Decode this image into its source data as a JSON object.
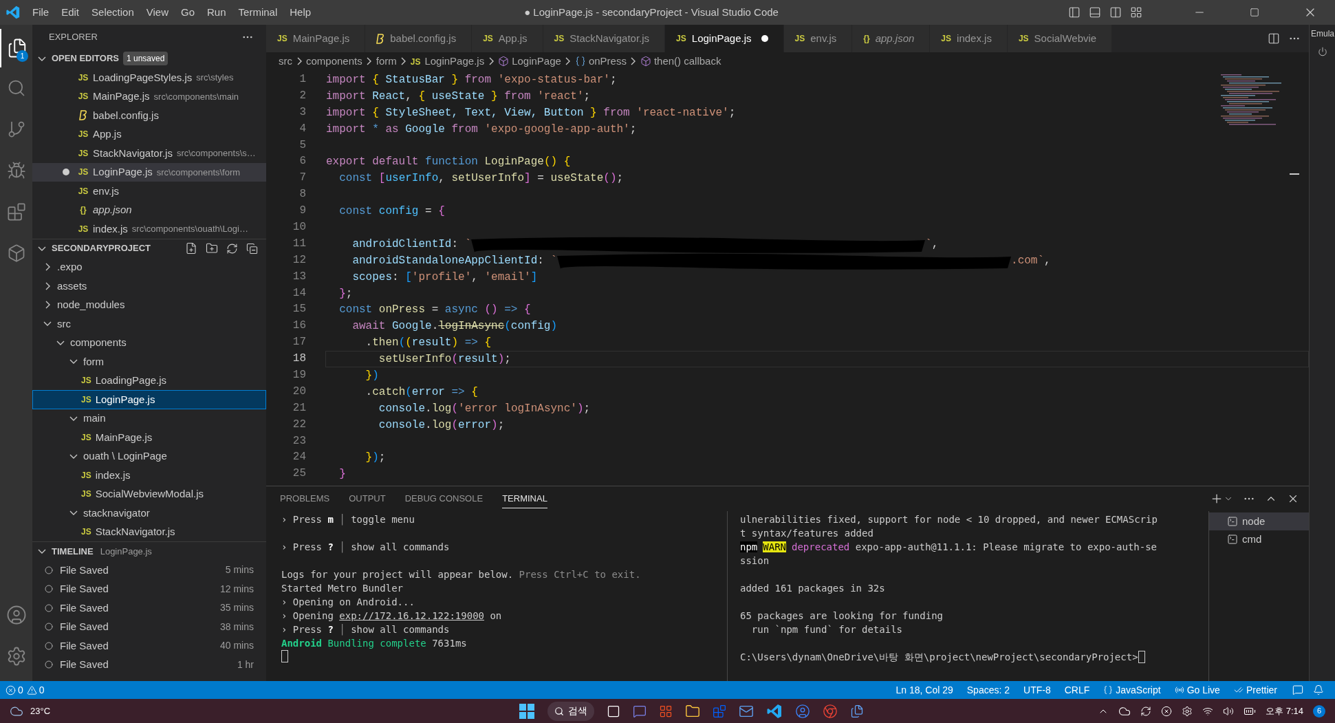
{
  "title_bar": {
    "menus": [
      "File",
      "Edit",
      "Selection",
      "View",
      "Go",
      "Run",
      "Terminal",
      "Help"
    ],
    "title": "● LoginPage.js - secondaryProject - Visual Studio Code"
  },
  "activity_bar": {
    "explorer_badge": "1"
  },
  "sidebar": {
    "title": "EXPLORER",
    "open_editors": {
      "title": "OPEN EDITORS",
      "badge": "1 unsaved",
      "items": [
        {
          "name": "LoadingPageStyles.js",
          "path": "src\\styles",
          "kind": "js",
          "icon_text": "JS",
          "modified": false,
          "selected": false,
          "preview": false
        },
        {
          "name": "MainPage.js",
          "path": "src\\components\\main",
          "kind": "js",
          "icon_text": "JS",
          "modified": false,
          "selected": false,
          "preview": false
        },
        {
          "name": "babel.config.js",
          "kind": "babel",
          "modified": false,
          "selected": false,
          "preview": false
        },
        {
          "name": "App.js",
          "kind": "js",
          "icon_text": "JS",
          "modified": false,
          "selected": false,
          "preview": false
        },
        {
          "name": "StackNavigator.js",
          "path": "src\\components\\s…",
          "kind": "js",
          "icon_text": "JS",
          "modified": false,
          "selected": false,
          "preview": false
        },
        {
          "name": "LoginPage.js",
          "path": "src\\components\\form",
          "kind": "js",
          "icon_text": "JS",
          "modified": true,
          "selected": true,
          "preview": false
        },
        {
          "name": "env.js",
          "kind": "js",
          "icon_text": "JS",
          "modified": false,
          "selected": false,
          "preview": false
        },
        {
          "name": "app.json",
          "kind": "json",
          "icon_text": "{}",
          "modified": false,
          "selected": false,
          "preview": true
        },
        {
          "name": "index.js",
          "path": "src\\components\\ouath\\Logi…",
          "kind": "js",
          "icon_text": "JS",
          "modified": false,
          "selected": false,
          "preview": false
        }
      ]
    },
    "project": {
      "title": "SECONDARYPROJECT",
      "tree": [
        {
          "label": ".expo",
          "kind": "folder",
          "expanded": false,
          "selected": false
        },
        {
          "label": "assets",
          "kind": "folder",
          "expanded": false,
          "selected": false
        },
        {
          "label": "node_modules",
          "kind": "folder",
          "expanded": false,
          "selected": false
        },
        {
          "label": "src",
          "kind": "folder",
          "expanded": true,
          "selected": false,
          "children": [
            {
              "label": "components",
              "kind": "folder",
              "expanded": true,
              "selected": false,
              "children": [
                {
                  "label": "form",
                  "kind": "folder",
                  "expanded": true,
                  "selected": false,
                  "children": [
                    {
                      "label": "LoadingPage.js",
                      "kind": "file",
                      "icon_text": "JS",
                      "selected": false
                    },
                    {
                      "label": "LoginPage.js",
                      "kind": "file",
                      "icon_text": "JS",
                      "selected": true
                    }
                  ]
                },
                {
                  "label": "main",
                  "kind": "folder",
                  "expanded": true,
                  "selected": false,
                  "children": [
                    {
                      "label": "MainPage.js",
                      "kind": "file",
                      "icon_text": "JS",
                      "selected": false
                    }
                  ]
                },
                {
                  "label": "ouath \\ LoginPage",
                  "kind": "folder",
                  "expanded": true,
                  "selected": false,
                  "children": [
                    {
                      "label": "index.js",
                      "kind": "file",
                      "icon_text": "JS",
                      "selected": false
                    },
                    {
                      "label": "SocialWebviewModal.js",
                      "kind": "file",
                      "icon_text": "JS",
                      "selected": false
                    }
                  ]
                },
                {
                  "label": "stacknavigator",
                  "kind": "folder",
                  "expanded": true,
                  "selected": false,
                  "children": [
                    {
                      "label": "StackNavigator.js",
                      "kind": "file",
                      "icon_text": "JS",
                      "selected": false
                    }
                  ]
                }
              ]
            }
          ]
        }
      ]
    },
    "timeline": {
      "title": "TIMELINE",
      "subtitle": "LoginPage.js",
      "items": [
        {
          "label": "File Saved",
          "time": "5 mins"
        },
        {
          "label": "File Saved",
          "time": "12 mins"
        },
        {
          "label": "File Saved",
          "time": "35 mins"
        },
        {
          "label": "File Saved",
          "time": "38 mins"
        },
        {
          "label": "File Saved",
          "time": "40 mins"
        },
        {
          "label": "File Saved",
          "time": "1 hr"
        }
      ]
    }
  },
  "tabs": [
    {
      "label": "MainPage.js",
      "kind": "js",
      "icon_text": "JS",
      "selected": false,
      "modified": false,
      "preview": false
    },
    {
      "label": "babel.config.js",
      "kind": "babel",
      "selected": false,
      "modified": false,
      "preview": false
    },
    {
      "label": "App.js",
      "kind": "js",
      "icon_text": "JS",
      "selected": false,
      "modified": false,
      "preview": false
    },
    {
      "label": "StackNavigator.js",
      "kind": "js",
      "icon_text": "JS",
      "selected": false,
      "modified": false,
      "preview": false
    },
    {
      "label": "LoginPage.js",
      "kind": "js",
      "icon_text": "JS",
      "selected": true,
      "modified": true,
      "preview": false
    },
    {
      "label": "env.js",
      "kind": "js",
      "icon_text": "JS",
      "selected": false,
      "modified": false,
      "preview": false
    },
    {
      "label": "app.json",
      "kind": "json",
      "icon_text": "{}",
      "selected": false,
      "modified": false,
      "preview": true
    },
    {
      "label": "index.js",
      "kind": "js",
      "icon_text": "JS",
      "selected": false,
      "modified": false,
      "preview": false
    },
    {
      "label": "SocialWebvie",
      "kind": "js",
      "icon_text": "JS",
      "selected": false,
      "modified": false,
      "preview": false
    }
  ],
  "breadcrumb": [
    {
      "text": "src",
      "kind": "folder"
    },
    {
      "text": "components",
      "kind": "folder"
    },
    {
      "text": "form",
      "kind": "folder"
    },
    {
      "text": "LoginPage.js",
      "kind": "file",
      "icon_text": "JS"
    },
    {
      "text": "LoginPage",
      "kind": "function"
    },
    {
      "text": "onPress",
      "kind": "variable"
    },
    {
      "text": "then() callback",
      "kind": "function"
    }
  ],
  "editor": {
    "lines": [
      {
        "number": "1",
        "current": false,
        "tokens": [
          {
            "text": "import ",
            "kind": "kw"
          },
          {
            "text": "{",
            "kind": "b1"
          },
          {
            "text": " StatusBar ",
            "kind": "var"
          },
          {
            "text": "}",
            "kind": "b1"
          },
          {
            "text": " from ",
            "kind": "kw"
          },
          {
            "text": "'expo-status-bar'",
            "kind": "str"
          },
          {
            "text": ";",
            "kind": "p"
          }
        ]
      },
      {
        "number": "2",
        "current": false,
        "tokens": [
          {
            "text": "import",
            "kind": "kw"
          },
          {
            "text": " React",
            "kind": "var"
          },
          {
            "text": ", ",
            "kind": "p"
          },
          {
            "text": "{",
            "kind": "b1"
          },
          {
            "text": " useState ",
            "kind": "var"
          },
          {
            "text": "}",
            "kind": "b1"
          },
          {
            "text": " from ",
            "kind": "kw"
          },
          {
            "text": "'react'",
            "kind": "str"
          },
          {
            "text": ";",
            "kind": "p"
          }
        ]
      },
      {
        "number": "3",
        "current": false,
        "tokens": [
          {
            "text": "import ",
            "kind": "kw"
          },
          {
            "text": "{",
            "kind": "b1"
          },
          {
            "text": " StyleSheet, Text, View, Button ",
            "kind": "var"
          },
          {
            "text": "}",
            "kind": "b1"
          },
          {
            "text": " from ",
            "kind": "kw"
          },
          {
            "text": "'react-native'",
            "kind": "str"
          },
          {
            "text": ";",
            "kind": "p"
          }
        ]
      },
      {
        "number": "4",
        "current": false,
        "tokens": [
          {
            "text": "import",
            "kind": "kw"
          },
          {
            "text": " * ",
            "kind": "storage"
          },
          {
            "text": "as",
            "kind": "kw"
          },
          {
            "text": " Google ",
            "kind": "var"
          },
          {
            "text": "from",
            "kind": "kw"
          },
          {
            "text": " 'expo-google-app-auth'",
            "kind": "str"
          },
          {
            "text": ";",
            "kind": "p"
          }
        ]
      },
      {
        "number": "5",
        "current": false
      },
      {
        "number": "6",
        "current": false,
        "tokens": [
          {
            "text": "export default ",
            "kind": "kw"
          },
          {
            "text": "function ",
            "kind": "storage"
          },
          {
            "text": "LoginPage",
            "kind": "fn"
          },
          {
            "text": "()",
            "kind": "b1"
          },
          {
            "text": " {",
            "kind": "b1"
          }
        ]
      },
      {
        "number": "7",
        "current": false,
        "tokens": [
          {
            "text": "  const ",
            "kind": "storage"
          },
          {
            "text": "[",
            "kind": "b2"
          },
          {
            "text": "userInfo",
            "kind": "const"
          },
          {
            "text": ", ",
            "kind": "p"
          },
          {
            "text": "setUserInfo",
            "kind": "fn"
          },
          {
            "text": "]",
            "kind": "b2"
          },
          {
            "text": " = ",
            "kind": "p"
          },
          {
            "text": "useState",
            "kind": "fn"
          },
          {
            "text": "()",
            "kind": "b2"
          },
          {
            "text": ";",
            "kind": "p"
          }
        ]
      },
      {
        "number": "8",
        "current": false
      },
      {
        "number": "9",
        "current": false,
        "tokens": [
          {
            "text": "  const ",
            "kind": "storage"
          },
          {
            "text": "config",
            "kind": "const"
          },
          {
            "text": " = ",
            "kind": "p"
          },
          {
            "text": "{",
            "kind": "b2"
          }
        ]
      },
      {
        "number": "10",
        "current": false
      },
      {
        "number": "11",
        "current": false,
        "tokens": [
          {
            "text": "    androidClientId",
            "kind": "var"
          },
          {
            "text": ": ",
            "kind": "p"
          },
          {
            "text": "`",
            "kind": "str"
          },
          {
            "kind": "redacted"
          },
          {
            "text": "`",
            "kind": "str"
          },
          {
            "text": ",",
            "kind": "p"
          }
        ]
      },
      {
        "number": "12",
        "current": false,
        "tokens": [
          {
            "text": "    androidStandaloneAppClientId",
            "kind": "var"
          },
          {
            "text": ": ",
            "kind": "p"
          },
          {
            "text": "`",
            "kind": "str"
          },
          {
            "kind": "redacted"
          },
          {
            "text": ".com`",
            "kind": "str"
          },
          {
            "text": ",",
            "kind": "p"
          }
        ]
      },
      {
        "number": "13",
        "current": false,
        "tokens": [
          {
            "text": "    scopes",
            "kind": "var"
          },
          {
            "text": ": ",
            "kind": "p"
          },
          {
            "text": "[",
            "kind": "b3"
          },
          {
            "text": "'profile'",
            "kind": "str"
          },
          {
            "text": ", ",
            "kind": "p"
          },
          {
            "text": "'email'",
            "kind": "str"
          },
          {
            "text": "]",
            "kind": "b3"
          }
        ]
      },
      {
        "number": "14",
        "current": false,
        "tokens": [
          {
            "text": "  }",
            "kind": "b2"
          },
          {
            "text": ";",
            "kind": "p"
          }
        ]
      },
      {
        "number": "15",
        "current": false,
        "tokens": [
          {
            "text": "  const ",
            "kind": "storage"
          },
          {
            "text": "onPress",
            "kind": "fn"
          },
          {
            "text": " = ",
            "kind": "p"
          },
          {
            "text": "async ",
            "kind": "storage"
          },
          {
            "text": "()",
            "kind": "b2"
          },
          {
            "text": " => ",
            "kind": "storage"
          },
          {
            "text": "{",
            "kind": "b2"
          }
        ]
      },
      {
        "number": "16",
        "current": false,
        "tokens": [
          {
            "text": "    await ",
            "kind": "kw"
          },
          {
            "text": "Google",
            "kind": "var"
          },
          {
            "text": ".",
            "kind": "p"
          },
          {
            "text": "logInAsync",
            "kind": "deprecated"
          },
          {
            "text": "(",
            "kind": "b3"
          },
          {
            "text": "config",
            "kind": "var"
          },
          {
            "text": ")",
            "kind": "b3"
          }
        ]
      },
      {
        "number": "17",
        "current": false,
        "tokens": [
          {
            "text": "      .",
            "kind": "p"
          },
          {
            "text": "then",
            "kind": "fn"
          },
          {
            "text": "(",
            "kind": "b3"
          },
          {
            "text": "(",
            "kind": "b1"
          },
          {
            "text": "result",
            "kind": "var"
          },
          {
            "text": ")",
            "kind": "b1"
          },
          {
            "text": " => ",
            "kind": "storage"
          },
          {
            "text": "{",
            "kind": "b1"
          }
        ]
      },
      {
        "number": "18",
        "current": true,
        "tokens": [
          {
            "text": "        setUserInfo",
            "kind": "fn"
          },
          {
            "text": "(",
            "kind": "b2"
          },
          {
            "text": "result",
            "kind": "var"
          },
          {
            "text": ")",
            "kind": "b2"
          },
          {
            "text": ";",
            "kind": "p"
          }
        ]
      },
      {
        "number": "19",
        "current": false,
        "tokens": [
          {
            "text": "      }",
            "kind": "b1"
          },
          {
            "text": ")",
            "kind": "b3"
          }
        ]
      },
      {
        "number": "20",
        "current": false,
        "tokens": [
          {
            "text": "      .",
            "kind": "p"
          },
          {
            "text": "catch",
            "kind": "fn"
          },
          {
            "text": "(",
            "kind": "b3"
          },
          {
            "text": "error",
            "kind": "var"
          },
          {
            "text": " => ",
            "kind": "storage"
          },
          {
            "text": "{",
            "kind": "b1"
          }
        ]
      },
      {
        "number": "21",
        "current": false,
        "tokens": [
          {
            "text": "        console",
            "kind": "var"
          },
          {
            "text": ".",
            "kind": "p"
          },
          {
            "text": "log",
            "kind": "fn"
          },
          {
            "text": "(",
            "kind": "b2"
          },
          {
            "text": "'error logInAsync'",
            "kind": "str"
          },
          {
            "text": ")",
            "kind": "b2"
          },
          {
            "text": ";",
            "kind": "p"
          }
        ]
      },
      {
        "number": "22",
        "current": false,
        "tokens": [
          {
            "text": "        console",
            "kind": "var"
          },
          {
            "text": ".",
            "kind": "p"
          },
          {
            "text": "log",
            "kind": "fn"
          },
          {
            "text": "(",
            "kind": "b2"
          },
          {
            "text": "error",
            "kind": "var"
          },
          {
            "text": ")",
            "kind": "b2"
          },
          {
            "text": ";",
            "kind": "p"
          }
        ]
      },
      {
        "number": "23",
        "current": false
      },
      {
        "number": "24",
        "current": false,
        "tokens": [
          {
            "text": "      }",
            "kind": "b1"
          },
          {
            "text": ")",
            "kind": "b3"
          },
          {
            "text": ";",
            "kind": "p"
          }
        ]
      },
      {
        "number": "25",
        "current": false,
        "tokens": [
          {
            "text": "  }",
            "kind": "b2"
          }
        ]
      }
    ]
  },
  "panel": {
    "tabs": [
      {
        "label": "PROBLEMS",
        "selected": false
      },
      {
        "label": "OUTPUT",
        "selected": false
      },
      {
        "label": "DEBUG CONSOLE",
        "selected": false
      },
      {
        "label": "TERMINAL",
        "selected": true
      }
    ],
    "terminal_left": [
      {
        "gap_before": false,
        "cursor": false,
        "segments": [
          {
            "text": "› Press ",
            "kind": "plain"
          },
          {
            "text": "m",
            "kind": "bold"
          },
          {
            "text": " │ ",
            "kind": "dim"
          },
          {
            "text": "toggle menu",
            "kind": "plain"
          }
        ]
      },
      {
        "gap_before": true,
        "cursor": false,
        "segments": [
          {
            "text": "› Press ",
            "kind": "plain"
          },
          {
            "text": "?",
            "kind": "bold"
          },
          {
            "text": " │ ",
            "kind": "dim"
          },
          {
            "text": "show all commands",
            "kind": "plain"
          }
        ]
      },
      {
        "gap_before": true,
        "cursor": false,
        "segments": [
          {
            "text": "Logs for your project will appear below. ",
            "kind": "plain"
          },
          {
            "text": "Press Ctrl+C to exit.",
            "kind": "dim"
          }
        ]
      },
      {
        "gap_before": false,
        "cursor": false,
        "segments": [
          {
            "text": "Started Metro Bundler",
            "kind": "plain"
          }
        ]
      },
      {
        "gap_before": false,
        "cursor": false,
        "segments": [
          {
            "text": "› Opening on Android...",
            "kind": "plain"
          }
        ]
      },
      {
        "gap_before": false,
        "cursor": false,
        "segments": [
          {
            "text": "› Opening ",
            "kind": "plain"
          },
          {
            "text": "exp://172.16.12.122:19000",
            "kind": "link"
          },
          {
            "text": " on",
            "kind": "plain"
          }
        ]
      },
      {
        "gap_before": false,
        "cursor": false,
        "segments": [
          {
            "text": "› Press ",
            "kind": "plain"
          },
          {
            "text": "?",
            "kind": "bold"
          },
          {
            "text": " │ ",
            "kind": "dim"
          },
          {
            "text": "show all commands",
            "kind": "plain"
          }
        ]
      },
      {
        "gap_before": false,
        "cursor": false,
        "segments": [
          {
            "text": "Android",
            "kind": "greenbold"
          },
          {
            "text": " Bundling complete ",
            "kind": "green"
          },
          {
            "text": "7631ms",
            "kind": "plain"
          }
        ]
      },
      {
        "gap_before": false,
        "cursor": true
      }
    ],
    "terminal_right": [
      {
        "gap_before": false,
        "cursor": false,
        "segments": [
          {
            "text": "ulnerabilities fixed, support for node < 10 dropped, and newer ECMAScrip",
            "kind": "plain"
          }
        ]
      },
      {
        "gap_before": false,
        "cursor": false,
        "segments": [
          {
            "text": "t syntax/features added",
            "kind": "plain"
          }
        ]
      },
      {
        "gap_before": false,
        "cursor": false,
        "segments": [
          {
            "text": "npm",
            "kind": "npm"
          },
          {
            "text": "WARN",
            "kind": "warn"
          },
          {
            "text": "deprecated",
            "kind": "magenta"
          },
          {
            "text": " expo-app-auth@11.1.1: Please migrate to expo-auth-se",
            "kind": "plain"
          }
        ]
      },
      {
        "gap_before": false,
        "cursor": false,
        "segments": [
          {
            "text": "ssion",
            "kind": "plain"
          }
        ]
      },
      {
        "gap_before": true,
        "cursor": false,
        "segments": [
          {
            "text": "added 161 packages in 32s",
            "kind": "plain"
          }
        ]
      },
      {
        "gap_before": true,
        "cursor": false,
        "segments": [
          {
            "text": "65 packages are looking for funding",
            "kind": "plain"
          }
        ]
      },
      {
        "gap_before": false,
        "cursor": false,
        "segments": [
          {
            "text": "  run `npm fund` for details",
            "kind": "plain"
          }
        ]
      },
      {
        "gap_before": true,
        "cursor": true,
        "segments": [
          {
            "text": "C:\\Users\\dynam\\OneDrive\\바탕 화면\\project\\newProject\\secondaryProject>",
            "kind": "plain"
          }
        ]
      }
    ],
    "terminals": [
      {
        "label": "node",
        "selected": true
      },
      {
        "label": "cmd",
        "selected": false
      }
    ]
  },
  "status_bar": {
    "errors": "0",
    "warnings": "0",
    "items": [
      {
        "text": "Ln 18, Col 29",
        "kind": "text"
      },
      {
        "text": "Spaces: 2",
        "kind": "text"
      },
      {
        "text": "UTF-8",
        "kind": "text"
      },
      {
        "text": "CRLF",
        "kind": "text"
      },
      {
        "text": "JavaScript",
        "kind": "language"
      },
      {
        "text": "Go Live",
        "kind": "live"
      },
      {
        "text": "Prettier",
        "kind": "prettier"
      }
    ]
  },
  "right_strip": {
    "title": "Emula"
  },
  "taskbar": {
    "weather": "23°C",
    "search": "검색",
    "time": "오후 7:14",
    "notification_count": "6"
  }
}
